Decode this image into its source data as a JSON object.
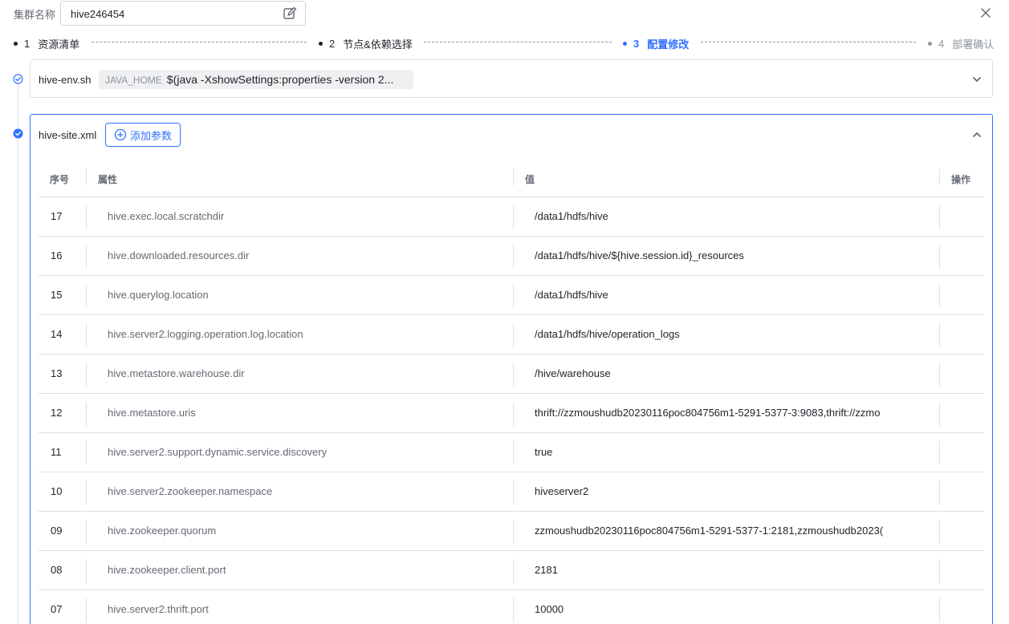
{
  "header": {
    "cluster_label": "集群名称",
    "cluster_name": "hive246454"
  },
  "steps": [
    {
      "num": "1",
      "label": "资源清单",
      "state": "done"
    },
    {
      "num": "2",
      "label": "节点&依赖选择",
      "state": "done"
    },
    {
      "num": "3",
      "label": "配置修改",
      "state": "active"
    },
    {
      "num": "4",
      "label": "部署确认",
      "state": "pending"
    }
  ],
  "panel_env": {
    "file_name": "hive-env.sh",
    "chip_key": "JAVA_HOME",
    "chip_value": "$(java -XshowSettings:properties -version 2..."
  },
  "panel_site": {
    "file_name": "hive-site.xml",
    "add_label": "添加参数"
  },
  "table": {
    "headers": {
      "index": "序号",
      "property": "属性",
      "value": "值",
      "action": "操作"
    },
    "rows": [
      {
        "index": "17",
        "property": "hive.exec.local.scratchdir",
        "value": "/data1/hdfs/hive"
      },
      {
        "index": "16",
        "property": "hive.downloaded.resources.dir",
        "value": "/data1/hdfs/hive/${hive.session.id}_resources"
      },
      {
        "index": "15",
        "property": "hive.querylog.location",
        "value": "/data1/hdfs/hive"
      },
      {
        "index": "14",
        "property": "hive.server2.logging.operation.log.location",
        "value": "/data1/hdfs/hive/operation_logs"
      },
      {
        "index": "13",
        "property": "hive.metastore.warehouse.dir",
        "value": "/hive/warehouse"
      },
      {
        "index": "12",
        "property": "hive.metastore.uris",
        "value": "thrift://zzmoushudb20230116poc804756m1-5291-5377-3:9083,thrift://zzmo"
      },
      {
        "index": "11",
        "property": "hive.server2.support.dynamic.service.discovery",
        "value": "true"
      },
      {
        "index": "10",
        "property": "hive.server2.zookeeper.namespace",
        "value": "hiveserver2"
      },
      {
        "index": "09",
        "property": "hive.zookeeper.quorum",
        "value": "zzmoushudb20230116poc804756m1-5291-5377-1:2181,zzmoushudb2023("
      },
      {
        "index": "08",
        "property": "hive.zookeeper.client.port",
        "value": "2181"
      },
      {
        "index": "07",
        "property": "hive.server2.thrift.port",
        "value": "10000"
      }
    ]
  },
  "colors": {
    "accent": "#3370ff",
    "border": "#dee0e3",
    "text": "#1f2329",
    "muted": "#646a73"
  }
}
